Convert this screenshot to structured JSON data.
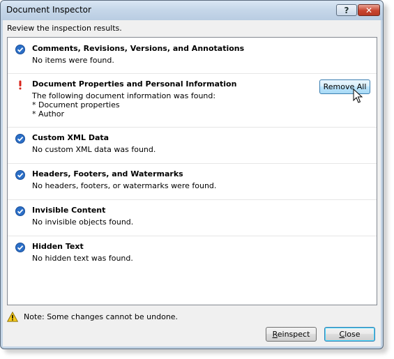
{
  "window": {
    "title": "Document Inspector",
    "help_label": "?",
    "close_glyph": "✕"
  },
  "instructions": "Review the inspection results.",
  "results": [
    {
      "status": "ok",
      "icon": "check-circle-icon",
      "title": "Comments, Revisions, Versions, and Annotations",
      "description": [
        "No items were found."
      ]
    },
    {
      "status": "found",
      "icon": "exclamation-icon",
      "title": "Document Properties and Personal Information",
      "description": [
        "The following document information was found:",
        "* Document properties",
        "* Author"
      ],
      "action_label": "Remove All"
    },
    {
      "status": "ok",
      "icon": "check-circle-icon",
      "title": "Custom XML Data",
      "description": [
        "No custom XML data was found."
      ]
    },
    {
      "status": "ok",
      "icon": "check-circle-icon",
      "title": "Headers, Footers, and Watermarks",
      "description": [
        "No headers, footers, or watermarks were found."
      ]
    },
    {
      "status": "ok",
      "icon": "check-circle-icon",
      "title": "Invisible Content",
      "description": [
        "No invisible objects found."
      ]
    },
    {
      "status": "ok",
      "icon": "check-circle-icon",
      "title": "Hidden Text",
      "description": [
        "No hidden text was found."
      ]
    }
  ],
  "note": {
    "icon": "warning-icon",
    "text": "Note: Some changes cannot be undone."
  },
  "buttons": {
    "reinspect": "Reinspect",
    "close": "Close"
  },
  "colors": {
    "check_blue": "#2b6fc7",
    "warning_red": "#d8231a",
    "warning_yellow": "#f5c91c"
  }
}
